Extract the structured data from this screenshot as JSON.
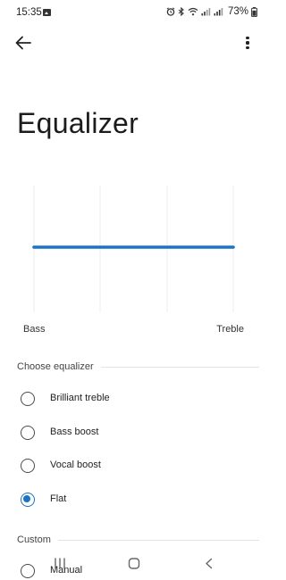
{
  "status_bar": {
    "time": "15:35",
    "battery": "73%",
    "icons": [
      "gallery-icon",
      "alarm-icon",
      "bluetooth-icon",
      "wifi-icon",
      "signal-icon",
      "signal-icon",
      "battery-icon"
    ]
  },
  "toolbar": {
    "back_icon": "arrow-left-icon",
    "more_icon": "more-vert-icon"
  },
  "page": {
    "title": "Equalizer"
  },
  "eq": {
    "left_label": "Bass",
    "right_label": "Treble",
    "band_levels": [
      0,
      0,
      0,
      0,
      0,
      0
    ],
    "line_color": "#1a73c7"
  },
  "presets": {
    "header": "Choose equalizer",
    "options": [
      {
        "label": "Brilliant treble",
        "selected": false
      },
      {
        "label": "Bass boost",
        "selected": false
      },
      {
        "label": "Vocal boost",
        "selected": false
      },
      {
        "label": "Flat",
        "selected": true
      }
    ]
  },
  "custom": {
    "header": "Custom",
    "options": [
      {
        "label": "Manual",
        "selected": false
      }
    ]
  },
  "nav_bar": {
    "icons": [
      "recent-apps-icon",
      "home-icon",
      "back-icon"
    ]
  },
  "colors": {
    "accent": "#1a73c7",
    "text": "#1f1f1f",
    "divider": "#e3e3e3"
  }
}
